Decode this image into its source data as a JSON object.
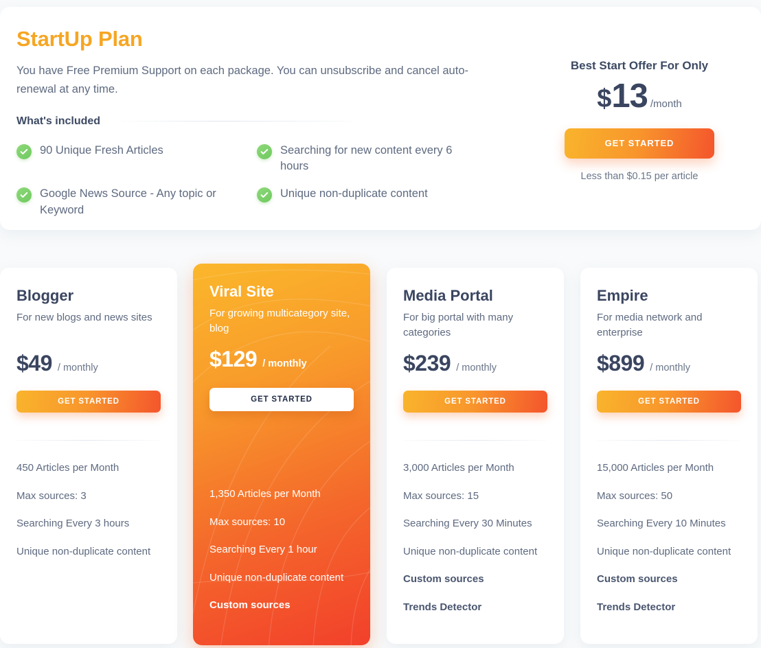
{
  "banner": {
    "title": "StartUp Plan",
    "subtitle": "You have Free Premium Support on each package. You can unsubscribe and cancel auto-renewal at any time.",
    "included_label": "What's included",
    "features": [
      "90 Unique Fresh Articles",
      "Searching for new content every 6 hours",
      "Google News Source - Any topic or Keyword",
      "Unique non-duplicate content"
    ],
    "offer": {
      "label": "Best Start Offer For Only",
      "currency": "$",
      "amount": "13",
      "period": "/month",
      "cta": "GET STARTED",
      "note": "Less than $0.15 per article"
    }
  },
  "plans": [
    {
      "name": "Blogger",
      "description": "For new blogs and news sites",
      "price": "$49",
      "period": "/ monthly",
      "cta": "GET STARTED",
      "featured": false,
      "features": [
        {
          "text": "450 Articles per Month",
          "bold": false
        },
        {
          "text": "Max sources: 3",
          "bold": false
        },
        {
          "text": "Searching Every 3 hours",
          "bold": false
        },
        {
          "text": "Unique non-duplicate content",
          "bold": false
        }
      ]
    },
    {
      "name": "Viral Site",
      "description": "For growing multicategory site, blog",
      "price": "$129",
      "period": "/ monthly",
      "cta": "GET STARTED",
      "featured": true,
      "features": [
        {
          "text": "1,350 Articles per Month",
          "bold": false
        },
        {
          "text": "Max sources: 10",
          "bold": false
        },
        {
          "text": "Searching Every 1 hour",
          "bold": false
        },
        {
          "text": "Unique non-duplicate content",
          "bold": false
        },
        {
          "text": "Custom sources",
          "bold": true
        }
      ]
    },
    {
      "name": "Media Portal",
      "description": "For big portal with many categories",
      "price": "$239",
      "period": "/ monthly",
      "cta": "GET STARTED",
      "featured": false,
      "features": [
        {
          "text": "3,000 Articles per Month",
          "bold": false
        },
        {
          "text": "Max sources: 15",
          "bold": false
        },
        {
          "text": "Searching Every 30 Minutes",
          "bold": false
        },
        {
          "text": "Unique non-duplicate content",
          "bold": false
        },
        {
          "text": "Custom sources",
          "bold": true
        },
        {
          "text": "Trends Detector",
          "bold": true
        }
      ]
    },
    {
      "name": "Empire",
      "description": "For media network and enterprise",
      "price": "$899",
      "period": "/ monthly",
      "cta": "GET STARTED",
      "featured": false,
      "features": [
        {
          "text": "15,000 Articles per Month",
          "bold": false
        },
        {
          "text": "Max sources: 50",
          "bold": false
        },
        {
          "text": "Searching Every 10 Minutes",
          "bold": false
        },
        {
          "text": "Unique non-duplicate content",
          "bold": false
        },
        {
          "text": "Custom sources",
          "bold": true
        },
        {
          "text": "Trends Detector",
          "bold": true
        }
      ]
    }
  ],
  "colors": {
    "accent_start": "#f9b42c",
    "accent_end": "#f4552c",
    "plan_title": "#f6a623",
    "heading": "#3a4560",
    "body_text": "#5e6a80",
    "check_green": "#6fc95f",
    "page_bg": "#f8fafb"
  },
  "icons": {
    "check": "check-icon"
  }
}
